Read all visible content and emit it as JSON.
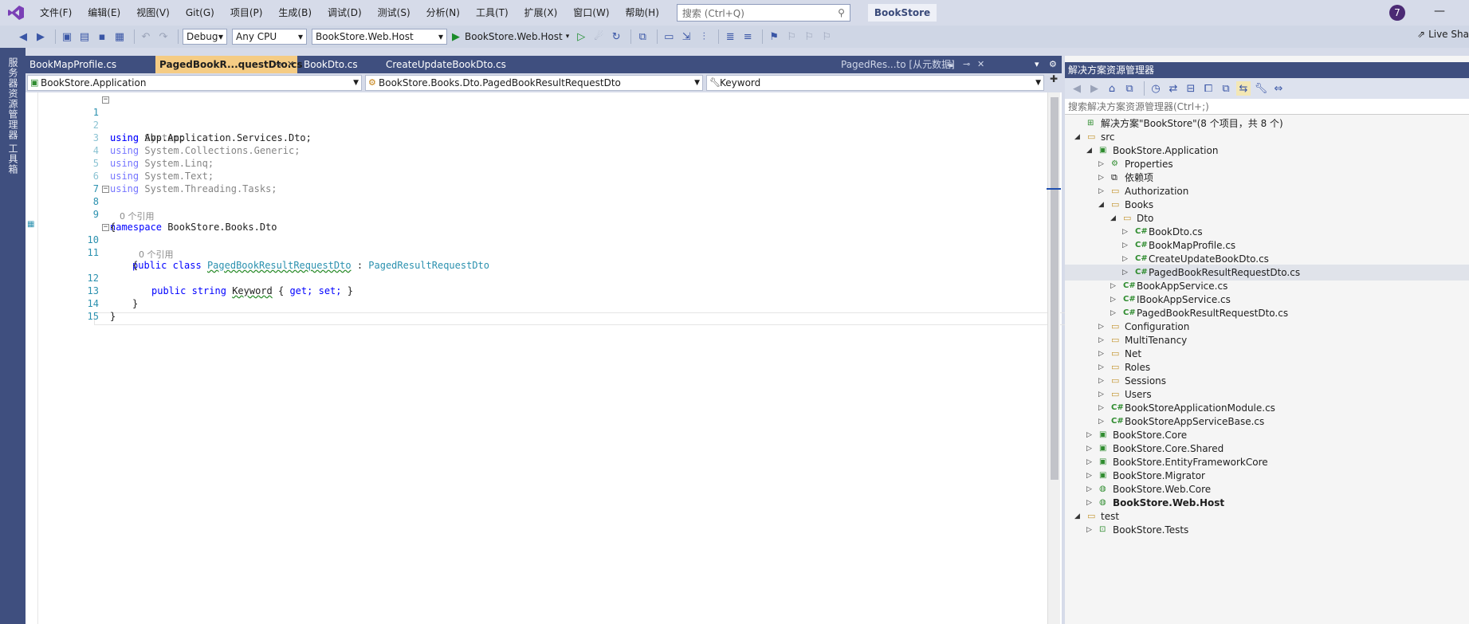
{
  "menubar": {
    "items": [
      "文件(F)",
      "编辑(E)",
      "视图(V)",
      "Git(G)",
      "项目(P)",
      "生成(B)",
      "调试(D)",
      "测试(S)",
      "分析(N)",
      "工具(T)",
      "扩展(X)",
      "窗口(W)",
      "帮助(H)"
    ],
    "search_placeholder": "搜索 (Ctrl+Q)",
    "solution_name": "BookStore",
    "user_initial": "7",
    "minimize": "—"
  },
  "toolbar": {
    "config": "Debug",
    "platform": "Any CPU",
    "startup_project": "BookStore.Web.Host",
    "run_label": "BookStore.Web.Host",
    "live_share": "Live Sha"
  },
  "left_strip": {
    "server_explorer": "服务器资源管理器",
    "toolbox": "工具箱"
  },
  "tabs": {
    "items": [
      {
        "label": "BookMapProfile.cs"
      },
      {
        "label": "PagedBookR...questDto.cs"
      },
      {
        "label": "BookDto.cs"
      },
      {
        "label": "CreateUpdateBookDto.cs"
      },
      {
        "label": "PagedRes...to [从元数据]"
      }
    ]
  },
  "navbar": {
    "project": "BookStore.Application",
    "type": "BookStore.Books.Dto.PagedBookResultRequestDto",
    "member": "Keyword"
  },
  "editor": {
    "codelens_refs": "0 个引用",
    "line_numbers": [
      "1",
      "2",
      "3",
      "4",
      "5",
      "6",
      "7",
      "8",
      "9",
      "10",
      "11",
      "12",
      "13",
      "14",
      "15"
    ],
    "code": {
      "using": "using",
      "ns_abp": "Abp.Application.Services.Dto;",
      "ns_system": "System;",
      "ns_collections": "System.Collections.Generic;",
      "ns_linq": "System.Linq;",
      "ns_text": "System.Text;",
      "ns_tasks": "System.Threading.Tasks;",
      "namespace_kw": "namespace",
      "namespace_name": "BookStore.Books.Dto",
      "open_brace": "{",
      "close_brace": "}",
      "public": "public",
      "class": "class",
      "class_name": "PagedBookResultRequestDto",
      "colon": ":",
      "base_class": "PagedResultRequestDto",
      "string": "string",
      "prop_name": "Keyword",
      "get": "get;",
      "set": "set;"
    }
  },
  "solution_explorer": {
    "title": "解决方案资源管理器",
    "search_placeholder": "搜索解决方案资源管理器(Ctrl+;)",
    "items": [
      {
        "label": "解决方案\"BookStore\"(8 个项目，共 8 个)"
      },
      {
        "label": "src"
      },
      {
        "label": "BookStore.Application"
      },
      {
        "label": "Properties"
      },
      {
        "label": "依赖项"
      },
      {
        "label": "Authorization"
      },
      {
        "label": "Books"
      },
      {
        "label": "Dto"
      },
      {
        "label": "BookDto.cs"
      },
      {
        "label": "BookMapProfile.cs"
      },
      {
        "label": "CreateUpdateBookDto.cs"
      },
      {
        "label": "PagedBookResultRequestDto.cs"
      },
      {
        "label": "BookAppService.cs"
      },
      {
        "label": "IBookAppService.cs"
      },
      {
        "label": "PagedBookResultRequestDto.cs"
      },
      {
        "label": "Configuration"
      },
      {
        "label": "MultiTenancy"
      },
      {
        "label": "Net"
      },
      {
        "label": "Roles"
      },
      {
        "label": "Sessions"
      },
      {
        "label": "Users"
      },
      {
        "label": "BookStoreApplicationModule.cs"
      },
      {
        "label": "BookStoreAppServiceBase.cs"
      },
      {
        "label": "BookStore.Core"
      },
      {
        "label": "BookStore.Core.Shared"
      },
      {
        "label": "BookStore.EntityFrameworkCore"
      },
      {
        "label": "BookStore.Migrator"
      },
      {
        "label": "BookStore.Web.Core"
      },
      {
        "label": "BookStore.Web.Host"
      },
      {
        "label": "test"
      },
      {
        "label": "BookStore.Tests"
      }
    ]
  }
}
